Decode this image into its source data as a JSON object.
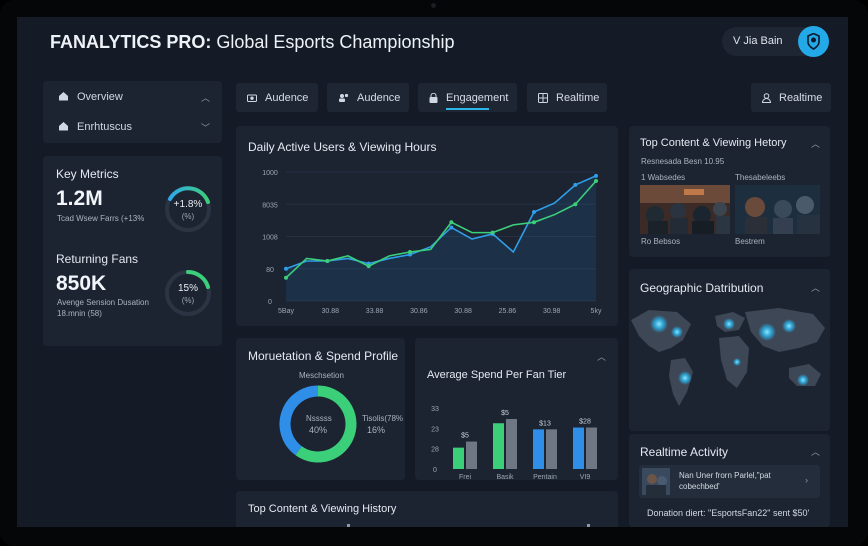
{
  "header": {
    "title_bold": "FANALYTICS PRO:",
    "title_rest": " Global Esports Championship",
    "user_label": "V Jia Bain"
  },
  "sidebar": {
    "items": [
      {
        "label": "Overview",
        "icon": "home-icon"
      },
      {
        "label": "Enrhtuscus",
        "icon": "home-icon"
      }
    ]
  },
  "tabs": [
    {
      "label": "Audence",
      "icon": "camera-icon"
    },
    {
      "label": "Audence",
      "icon": "users-icon"
    },
    {
      "label": "Engagement",
      "icon": "lock-icon",
      "active": true
    },
    {
      "label": "Realtime",
      "icon": "grid-icon"
    }
  ],
  "realtime_button": "Realtime",
  "key_metrics": {
    "title": "Key Metrics",
    "m1_value": "1.2M",
    "m1_sub": "Tcad Wsew Farrs (+13%",
    "m1_ring_value": "+1.8%",
    "m1_ring_sub": "(%)",
    "m2_title": "Returning Fans",
    "m2_value": "850K",
    "m2_sub1": "Avenge Sension Dusation",
    "m2_sub2": "18.mnin (58)",
    "m2_ring_value": "15%",
    "m2_ring_sub": "(%)"
  },
  "main_chart": {
    "title": "Daily Active Users & Viewing Hours",
    "chart_data": {
      "type": "line",
      "yticks": [
        "1000",
        "8035",
        "1008",
        "80",
        "0"
      ],
      "xticks": [
        "5Bay",
        "30.88",
        "33.88",
        "30.86",
        "30.88",
        "25.86",
        "30.98",
        "5ky"
      ],
      "series": [
        {
          "values": [
            0.25,
            0.31,
            0.31,
            0.33,
            0.29,
            0.33,
            0.36,
            0.42,
            0.57,
            0.48,
            0.52,
            0.38,
            0.69,
            0.76,
            0.9,
            0.97
          ]
        },
        {
          "values": [
            0.18,
            0.33,
            0.31,
            0.35,
            0.27,
            0.35,
            0.38,
            0.4,
            0.61,
            0.53,
            0.53,
            0.59,
            0.61,
            0.67,
            0.75,
            0.93
          ]
        }
      ]
    }
  },
  "top_content": {
    "title": "Top Content & Viewing Hetory",
    "subtitle": "Resnesada Besn 10.95",
    "left_label": "1 Wabsedes",
    "right_label": "Thesabeleebs",
    "left_caption": "Ro Bebsos",
    "right_caption": "Bestrem"
  },
  "geo": {
    "title": "Geographic Datribution"
  },
  "monetization": {
    "title": "Moruetation & Spend Profile",
    "donut_top": "Meschsetion",
    "donut_center1": "Nsssss",
    "donut_center2": "40%",
    "right1": "Tisolis(78%",
    "right2": "16%",
    "chart_data": {
      "type": "pie",
      "values": [
        60,
        40
      ],
      "colors": [
        "#3ccf7a",
        "#2f8ee8"
      ]
    }
  },
  "spend": {
    "title": "Average Spend Per Fan Tier",
    "chart_data": {
      "type": "bar",
      "categories": [
        "Frei",
        "Basik",
        "Pentain",
        "VI9"
      ],
      "yticks": [
        "33",
        "23",
        "28",
        "0"
      ],
      "labels": [
        "$5",
        "$5",
        "$13",
        "$28"
      ],
      "series": [
        {
          "color": "#3ccf7a",
          "values": [
            0.35,
            0.75,
            0.65,
            0.68
          ]
        },
        {
          "color": "#6f7784",
          "values": [
            0.45,
            0.82,
            0.65,
            0.68
          ]
        }
      ],
      "primary_colors": [
        "#3ccf7a",
        "#3ccf7a",
        "#2f8ee8",
        "#2f8ee8"
      ]
    }
  },
  "activity": {
    "title": "Realtime Activity",
    "item1_line1": "Nan Uner frorn Parlel,\"pat",
    "item1_line2": "cobechbed'",
    "item2": "Donation diert: \"EsportsFan22\" sent $50'"
  },
  "bottom_panel": {
    "title": "Top Content & Viewing History"
  }
}
